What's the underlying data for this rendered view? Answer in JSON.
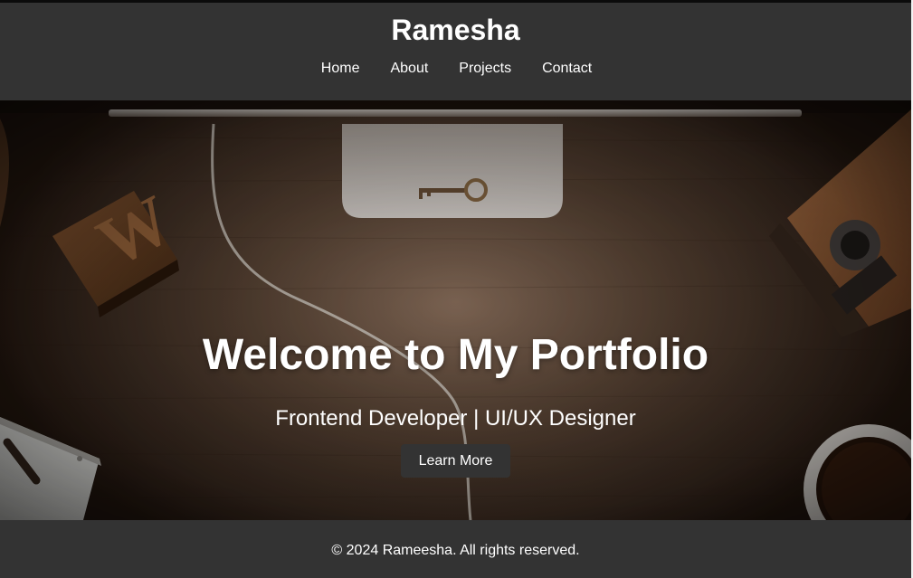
{
  "header": {
    "site_title": "Ramesha",
    "nav": [
      {
        "label": "Home"
      },
      {
        "label": "About"
      },
      {
        "label": "Projects"
      },
      {
        "label": "Contact"
      }
    ]
  },
  "hero": {
    "heading": "Welcome to My Portfolio",
    "subheading": "Frontend Developer | UI/UX Designer",
    "button_label": "Learn More"
  },
  "footer": {
    "copyright": "© 2024 Rameesha. All rights reserved."
  },
  "colors": {
    "header_background": "#333333",
    "footer_background": "#333333",
    "button_background": "#333333",
    "text": "#ffffff",
    "hero_tone": "#5d4737"
  }
}
